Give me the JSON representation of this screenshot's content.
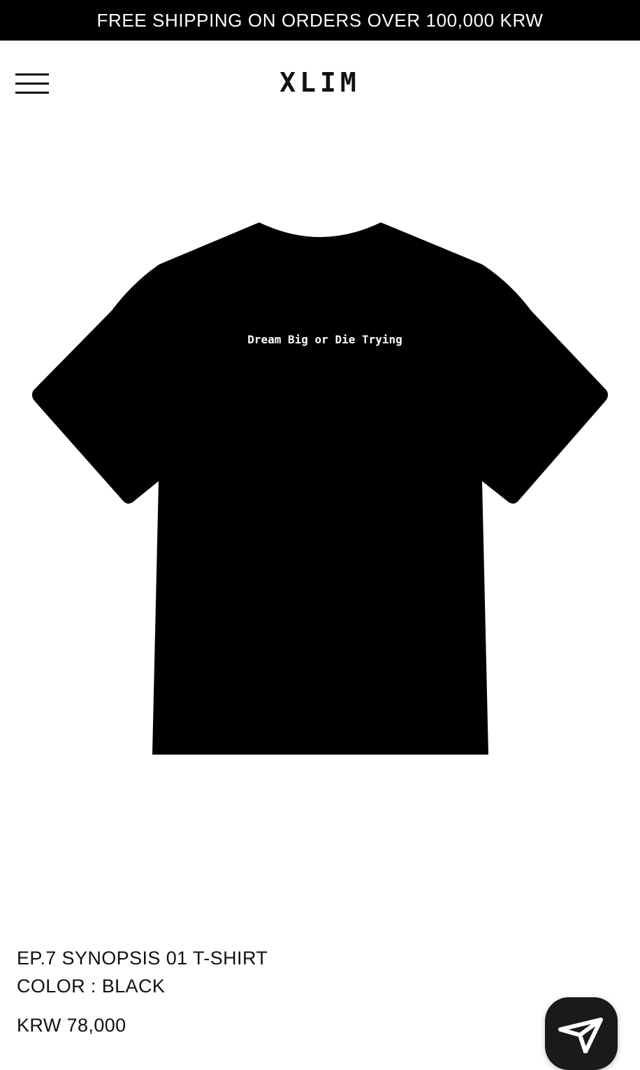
{
  "announcement": {
    "text": "FREE SHIPPING ON ORDERS OVER 100,000 KRW"
  },
  "header": {
    "menu_icon": "hamburger-menu-icon",
    "logo": "XLIM"
  },
  "product": {
    "image_alt_print_text": "Dream Big or Die Trying",
    "name": "EP.7 SYNOPSIS 01 T-SHIRT",
    "color": "COLOR : BLACK",
    "price": "KRW 78,000",
    "garment_color": "#000000"
  },
  "floating": {
    "chat_icon": "send-arrow-icon"
  },
  "colors": {
    "announcement_bg": "#000000",
    "announcement_text": "#ffffff",
    "text": "#111111",
    "background": "#ffffff"
  }
}
